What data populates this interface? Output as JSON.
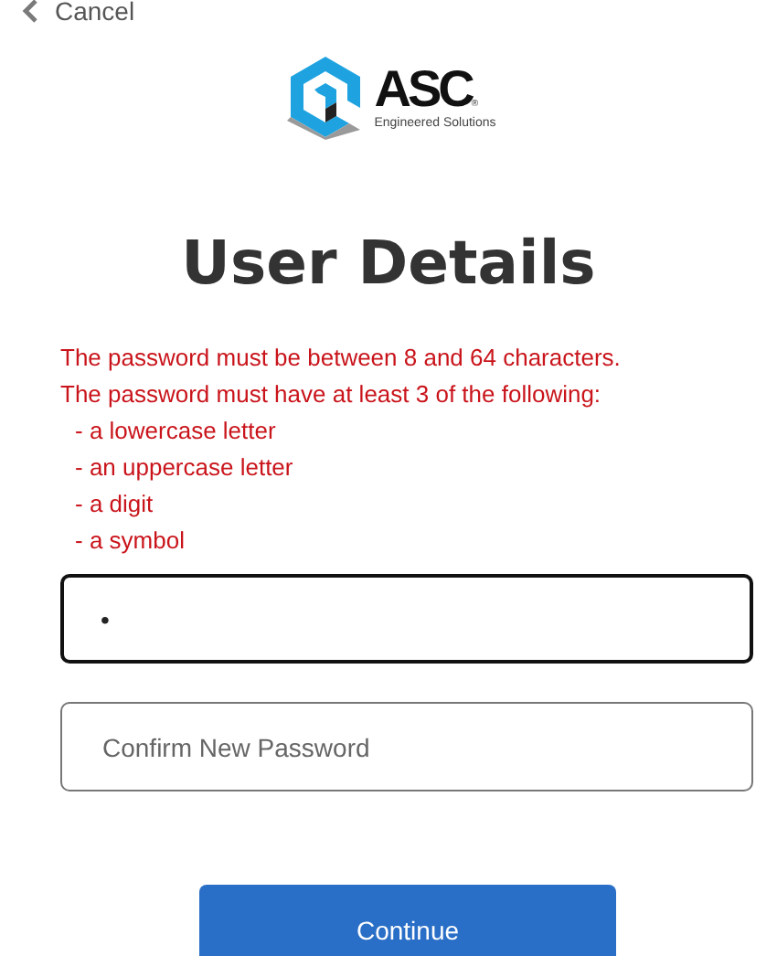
{
  "nav": {
    "back_label": "Cancel"
  },
  "logo": {
    "name": "ASC",
    "mark": "®",
    "tagline": "Engineered Solutions"
  },
  "title": "User Details",
  "errors": {
    "messages": [
      "The password must be between 8 and 64 characters.",
      "The password must have at least 3 of the following:"
    ],
    "requirements": [
      "- a lowercase letter",
      "- an uppercase letter",
      "- a digit",
      "- a symbol"
    ]
  },
  "fields": [
    {
      "value": "•",
      "focused": true
    },
    {
      "placeholder": "Confirm New Password",
      "focused": false
    }
  ],
  "buttons": [
    "Continue"
  ]
}
